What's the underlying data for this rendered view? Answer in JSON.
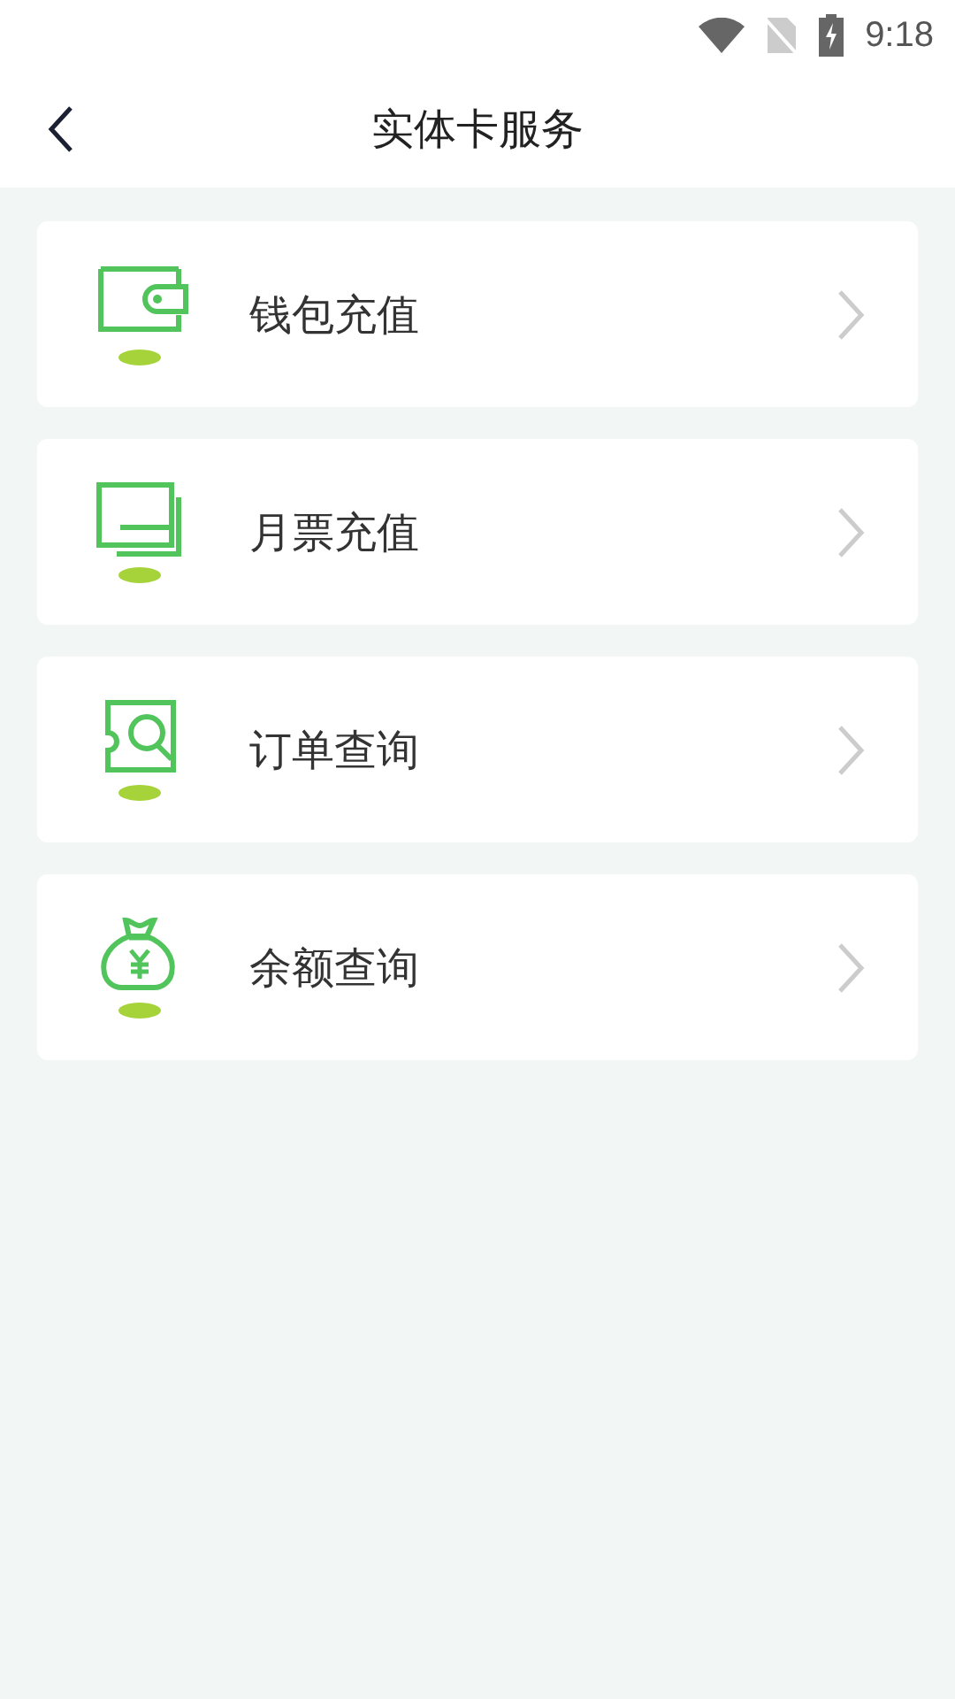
{
  "status_bar": {
    "time": "9:18"
  },
  "header": {
    "title": "实体卡服务"
  },
  "menu": [
    {
      "kind": "wallet",
      "label": "钱包充值"
    },
    {
      "kind": "pass",
      "label": "月票充值"
    },
    {
      "kind": "order",
      "label": "订单查询"
    },
    {
      "kind": "balance",
      "label": "余额查询"
    }
  ]
}
